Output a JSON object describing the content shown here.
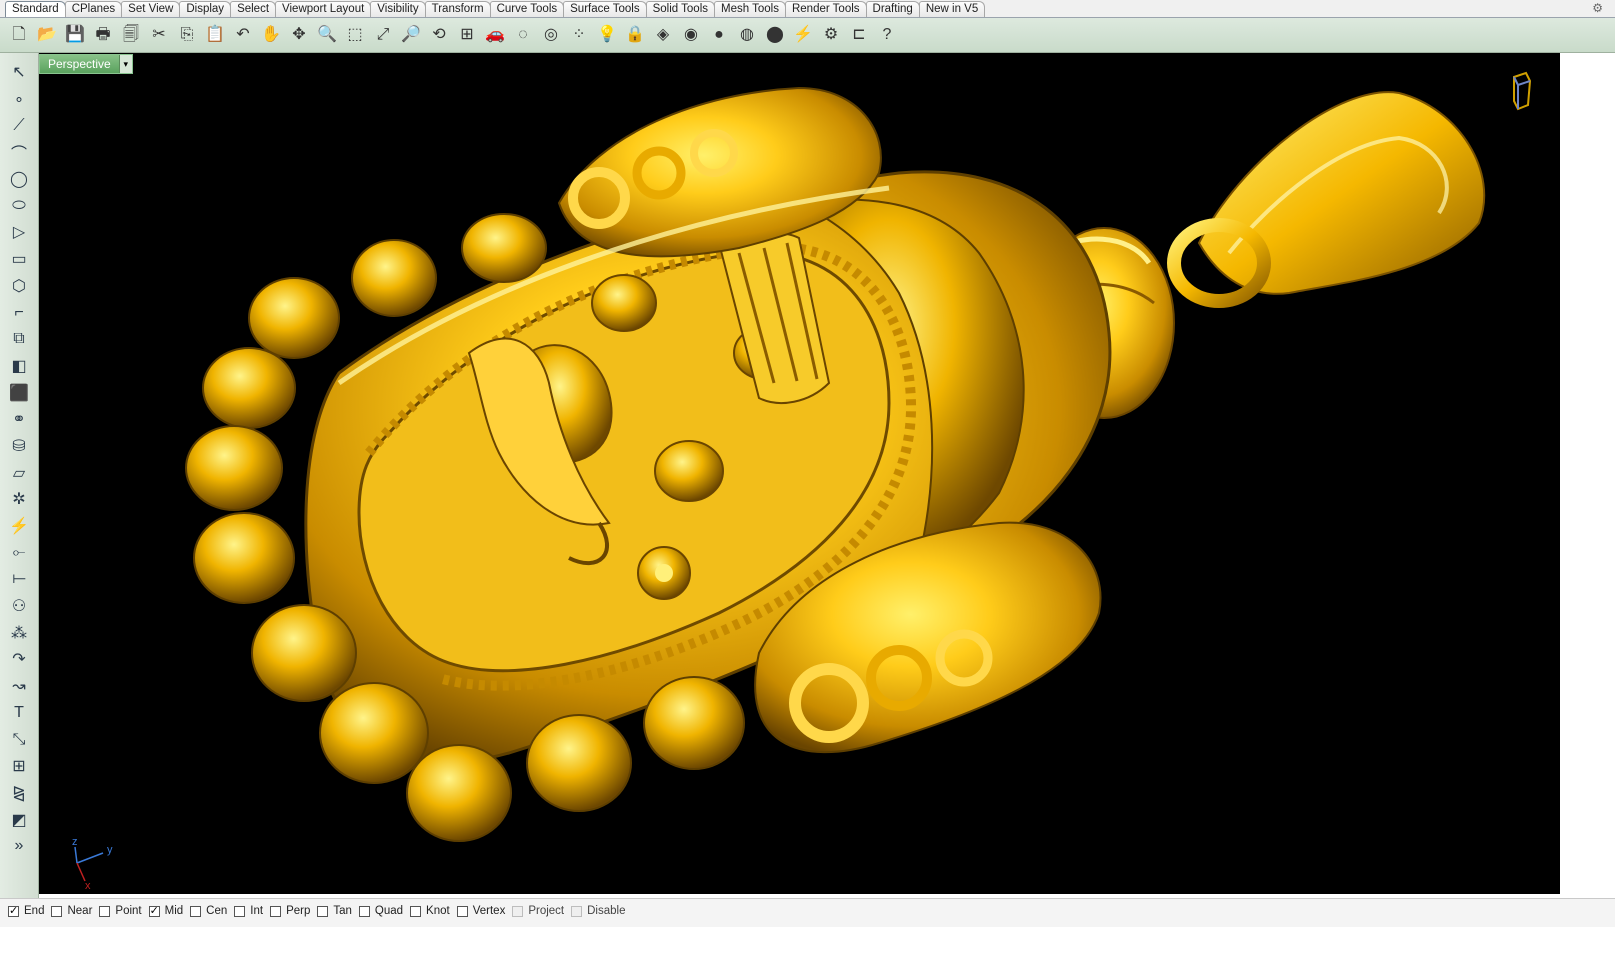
{
  "tabs": [
    {
      "label": "Standard",
      "active": true
    },
    {
      "label": "CPlanes"
    },
    {
      "label": "Set View"
    },
    {
      "label": "Display"
    },
    {
      "label": "Select"
    },
    {
      "label": "Viewport Layout"
    },
    {
      "label": "Visibility"
    },
    {
      "label": "Transform"
    },
    {
      "label": "Curve Tools"
    },
    {
      "label": "Surface Tools"
    },
    {
      "label": "Solid Tools"
    },
    {
      "label": "Mesh Tools"
    },
    {
      "label": "Render Tools"
    },
    {
      "label": "Drafting"
    },
    {
      "label": "New in V5"
    }
  ],
  "toolbar": {
    "icons": [
      {
        "name": "new-file-icon",
        "glyph": "🗋"
      },
      {
        "name": "open-folder-icon",
        "glyph": "📂"
      },
      {
        "name": "save-icon",
        "glyph": "💾"
      },
      {
        "name": "print-icon",
        "glyph": "🖶"
      },
      {
        "name": "copy-document-icon",
        "glyph": "🗐"
      },
      {
        "name": "cut-icon",
        "glyph": "✂"
      },
      {
        "name": "copy-icon",
        "glyph": "⎘"
      },
      {
        "name": "paste-icon",
        "glyph": "📋"
      },
      {
        "name": "undo-icon",
        "glyph": "↶"
      },
      {
        "name": "pan-hand-icon",
        "glyph": "✋"
      },
      {
        "name": "move-icon",
        "glyph": "✥"
      },
      {
        "name": "zoom-icon",
        "glyph": "🔍"
      },
      {
        "name": "zoom-window-icon",
        "glyph": "⬚"
      },
      {
        "name": "zoom-extents-icon",
        "glyph": "⤢"
      },
      {
        "name": "zoom-selected-icon",
        "glyph": "🔎"
      },
      {
        "name": "rotate-view-icon",
        "glyph": "⟲"
      },
      {
        "name": "four-viewports-icon",
        "glyph": "⊞"
      },
      {
        "name": "car-icon",
        "glyph": "🚗"
      },
      {
        "name": "hide-icon",
        "glyph": "◌"
      },
      {
        "name": "show-icon",
        "glyph": "◎"
      },
      {
        "name": "points-icon",
        "glyph": "⁘"
      },
      {
        "name": "lightbulb-icon",
        "glyph": "💡"
      },
      {
        "name": "lock-icon",
        "glyph": "🔒"
      },
      {
        "name": "layer-icon",
        "glyph": "◈"
      },
      {
        "name": "color-wheel-icon",
        "glyph": "◉"
      },
      {
        "name": "render-sphere-icon",
        "glyph": "●"
      },
      {
        "name": "wireframe-sphere-icon",
        "glyph": "◍"
      },
      {
        "name": "shaded-sphere-icon",
        "glyph": "⬤"
      },
      {
        "name": "light-icon",
        "glyph": "⚡"
      },
      {
        "name": "settings-gear-icon",
        "glyph": "⚙"
      },
      {
        "name": "dimension-icon",
        "glyph": "⊏"
      },
      {
        "name": "help-icon",
        "glyph": "?"
      }
    ]
  },
  "left_tools": [
    {
      "name": "select-arrow-icon",
      "glyph": "↖"
    },
    {
      "name": "point-icon",
      "glyph": "∘"
    },
    {
      "name": "polyline-icon",
      "glyph": "⟋"
    },
    {
      "name": "curve-icon",
      "glyph": "⌒"
    },
    {
      "name": "circle-icon",
      "glyph": "◯"
    },
    {
      "name": "ellipse-icon",
      "glyph": "⬭"
    },
    {
      "name": "polygon-icon",
      "glyph": "▷"
    },
    {
      "name": "rectangle-icon",
      "glyph": "▭"
    },
    {
      "name": "hexagon-icon",
      "glyph": "⬡"
    },
    {
      "name": "fillet-icon",
      "glyph": "⌐"
    },
    {
      "name": "offset-icon",
      "glyph": "⧉"
    },
    {
      "name": "surface-icon",
      "glyph": "◧"
    },
    {
      "name": "box-solid-icon",
      "glyph": "⬛"
    },
    {
      "name": "boolean-icon",
      "glyph": "⚭"
    },
    {
      "name": "cylinder-icon",
      "glyph": "⛁"
    },
    {
      "name": "plane-icon",
      "glyph": "▱"
    },
    {
      "name": "gear-tool-icon",
      "glyph": "✲"
    },
    {
      "name": "split-icon",
      "glyph": "⚡"
    },
    {
      "name": "trim-icon",
      "glyph": "⟜"
    },
    {
      "name": "extend-icon",
      "glyph": "⟝"
    },
    {
      "name": "group-icon",
      "glyph": "⚇"
    },
    {
      "name": "array-icon",
      "glyph": "⁂"
    },
    {
      "name": "arc-icon",
      "glyph": "↷"
    },
    {
      "name": "blend-icon",
      "glyph": "↝"
    },
    {
      "name": "text-icon",
      "glyph": "T"
    },
    {
      "name": "scale-icon",
      "glyph": "⤡"
    },
    {
      "name": "array-grid-icon",
      "glyph": "⊞"
    },
    {
      "name": "mirror-icon",
      "glyph": "⧎"
    },
    {
      "name": "cube-icon",
      "glyph": "◩"
    },
    {
      "name": "more-icon",
      "glyph": "»"
    }
  ],
  "viewport": {
    "label": "Perspective",
    "dropdown_glyph": "▾",
    "axes": {
      "x": "x",
      "y": "y",
      "z": "z"
    }
  },
  "colors": {
    "gold_light": "#ffd84a",
    "gold_mid": "#e0a800",
    "gold_dark": "#7a5200",
    "background": "#000000"
  },
  "osnaps": [
    {
      "label": "End",
      "checked": true
    },
    {
      "label": "Near",
      "checked": false
    },
    {
      "label": "Point",
      "checked": false
    },
    {
      "label": "Mid",
      "checked": true
    },
    {
      "label": "Cen",
      "checked": false
    },
    {
      "label": "Int",
      "checked": false
    },
    {
      "label": "Perp",
      "checked": false
    },
    {
      "label": "Tan",
      "checked": false
    },
    {
      "label": "Quad",
      "checked": false
    },
    {
      "label": "Knot",
      "checked": false
    },
    {
      "label": "Vertex",
      "checked": false
    },
    {
      "label": "Project",
      "checked": false,
      "disabled": true
    },
    {
      "label": "Disable",
      "checked": false,
      "disabled": true
    }
  ]
}
